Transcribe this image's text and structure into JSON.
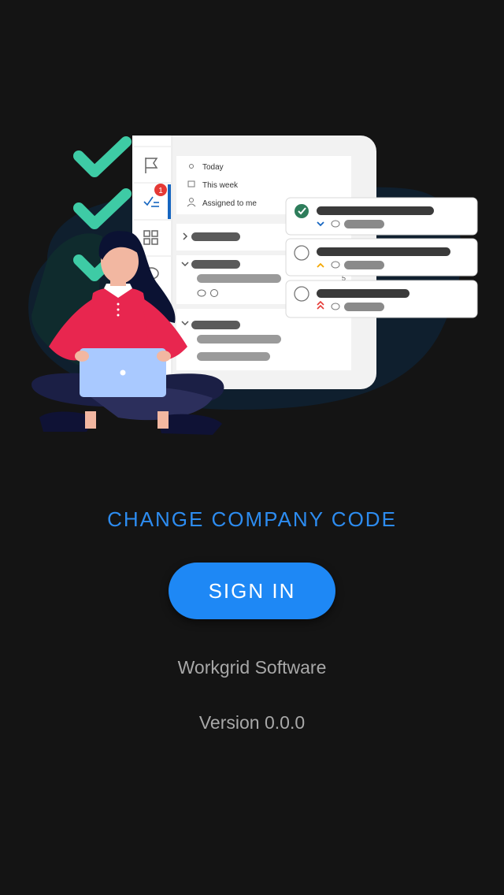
{
  "illustration": {
    "filters": [
      "Today",
      "This week",
      "Assigned to me"
    ],
    "badge_count": "1",
    "small_number": "5",
    "icons": [
      "flag-icon",
      "task-list-icon",
      "grid-icon",
      "chat-icon",
      "sun-icon",
      "calendar-icon",
      "person-icon",
      "check-circle-icon"
    ],
    "accent_colors": {
      "check": "#3ecba5",
      "shirt": "#e8264f",
      "badge": "#e53935",
      "nav_active": "#1565c0"
    }
  },
  "actions": {
    "change_company_code": "CHANGE COMPANY CODE",
    "sign_in": "SIGN IN"
  },
  "footer": {
    "company": "Workgrid Software",
    "version": "Version 0.0.0"
  }
}
